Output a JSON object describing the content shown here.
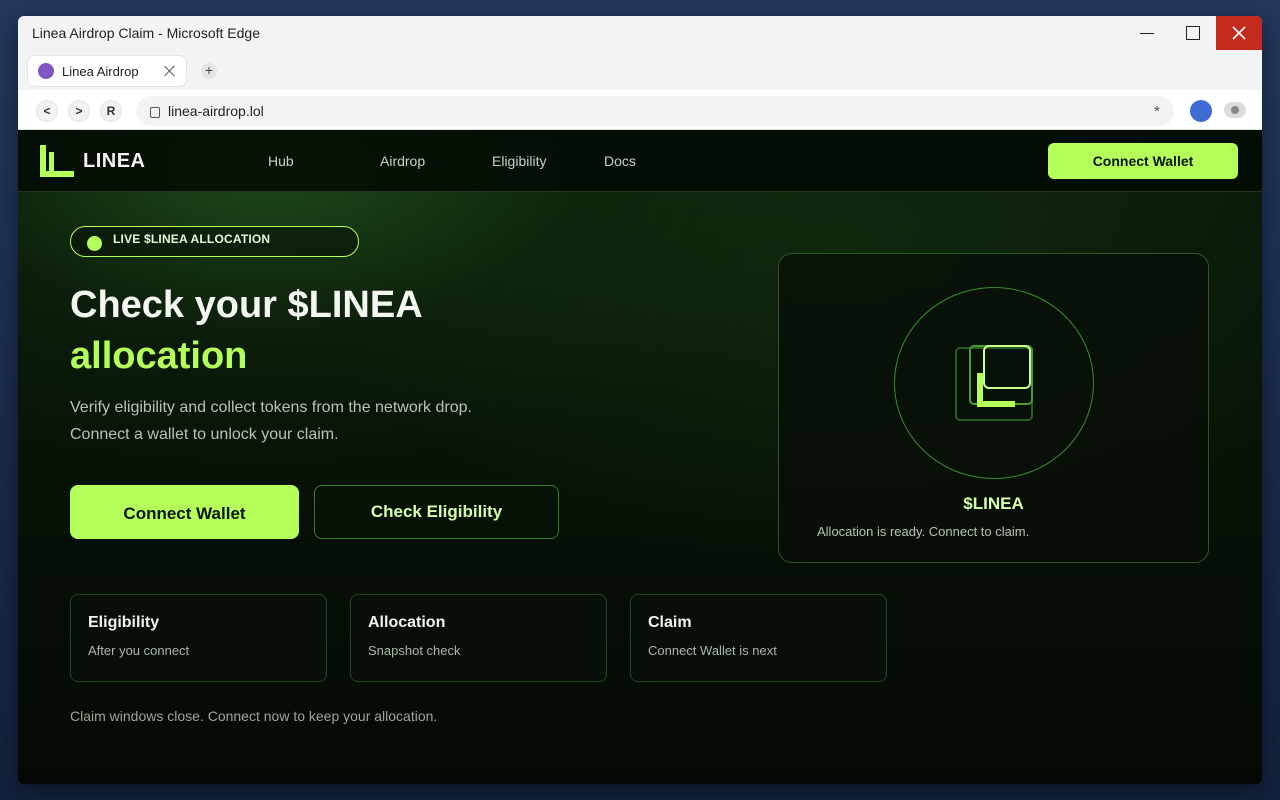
{
  "window": {
    "title": "Linea Airdrop Claim - Microsoft Edge"
  },
  "tab": {
    "label": "Linea Airdrop"
  },
  "browser": {
    "back": "<",
    "forward": ">",
    "reload": "R",
    "new_tab": "+",
    "url": "linea-airdrop.lol",
    "star": "*"
  },
  "site": {
    "logo_text": "LINEA",
    "nav": [
      "Hub",
      "Airdrop",
      "Eligibility",
      "Docs"
    ],
    "connect_label": "Connect Wallet"
  },
  "hero": {
    "badge": "LIVE $LINEA ALLOCATION",
    "title_line1": "Check your $LINEA",
    "title_line2": "allocation",
    "sub_line1": "Verify eligibility and collect tokens from the network drop.",
    "sub_line2": "Connect a wallet to unlock your claim.",
    "primary_cta": "Connect Wallet",
    "secondary_cta": "Check Eligibility"
  },
  "token_card": {
    "name": "$LINEA",
    "desc": "Allocation is ready. Connect to claim."
  },
  "info_cards": [
    {
      "title": "Eligibility",
      "sub": "After you connect"
    },
    {
      "title": "Allocation",
      "sub": "Snapshot check"
    },
    {
      "title": "Claim",
      "sub": "Connect Wallet is next"
    }
  ],
  "footnote": "Claim windows close. Connect now to keep your allocation.",
  "colors": {
    "accent": "#b5ff5a",
    "close_red": "#c42b1c",
    "profile_blue": "#3e6bd4",
    "tab_favicon": "#7e57c2"
  }
}
